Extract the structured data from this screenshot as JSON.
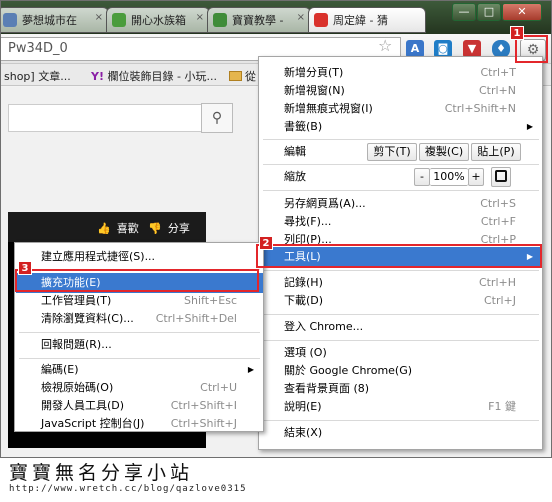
{
  "tabs": [
    {
      "label": "夢想城市在",
      "close": "×",
      "icon_color": "#5a7fb4"
    },
    {
      "label": "開心水族箱",
      "close": "×",
      "icon_color": "#4a9c3c"
    },
    {
      "label": "寶寶教學 -",
      "close": "×",
      "icon_color": "#3f8c38"
    },
    {
      "label": "周定緯 - 猜",
      "close": "×",
      "icon_color": "#d9322c"
    }
  ],
  "window_controls": {
    "minimize": "—",
    "maximize": "□",
    "close": "✕"
  },
  "address": {
    "text": "Pw34D_0"
  },
  "toolbar_icons": [
    "star-icon",
    "translate-icon",
    "camera-icon",
    "thumb-down-icon",
    "shield-icon",
    "wrench-icon"
  ],
  "bookmarks": [
    {
      "label": "shop] 文章..."
    },
    {
      "label": "欄位裝飾目錄 - 小玩..."
    },
    {
      "label": "從"
    }
  ],
  "page_content": {
    "like_label": "喜歡",
    "share_label": "分享"
  },
  "menu": {
    "items": [
      {
        "label": "新增分頁(T)",
        "shortcut": "Ctrl+T"
      },
      {
        "label": "新增視窗(N)",
        "shortcut": "Ctrl+N"
      },
      {
        "label": "新增無痕式視窗(I)",
        "shortcut": "Ctrl+Shift+N"
      },
      {
        "label": "書籤(B)",
        "shortcut": ""
      },
      {
        "label": "編輯",
        "shortcut": ""
      },
      {
        "label": "縮放",
        "shortcut": ""
      },
      {
        "label": "另存網頁爲(A)...",
        "shortcut": "Ctrl+S"
      },
      {
        "label": "尋找(F)...",
        "shortcut": "Ctrl+F"
      },
      {
        "label": "列印(P)...",
        "shortcut": "Ctrl+P"
      },
      {
        "label": "工具(L)",
        "shortcut": ""
      },
      {
        "label": "記錄(H)",
        "shortcut": "Ctrl+H"
      },
      {
        "label": "下載(D)",
        "shortcut": "Ctrl+J"
      },
      {
        "label": "登入 Chrome...",
        "shortcut": ""
      },
      {
        "label": "選項 (O)",
        "shortcut": ""
      },
      {
        "label": "關於 Google Chrome(G)",
        "shortcut": ""
      },
      {
        "label": "查看背景頁面 (8)",
        "shortcut": ""
      },
      {
        "label": "說明(E)",
        "shortcut": "F1 鍵"
      },
      {
        "label": "結束(X)",
        "shortcut": ""
      }
    ],
    "edit_buttons": {
      "cut": "剪下(T)",
      "copy": "複製(C)",
      "paste": "貼上(P)"
    },
    "zoom": {
      "minus": "-",
      "value": "100%",
      "plus": "+"
    }
  },
  "submenu": {
    "items": [
      {
        "label": "建立應用程式捷徑(S)...",
        "shortcut": ""
      },
      {
        "label": "擴充功能(E)",
        "shortcut": ""
      },
      {
        "label": "工作管理員(T)",
        "shortcut": "Shift+Esc"
      },
      {
        "label": "清除瀏覽資料(C)...",
        "shortcut": "Ctrl+Shift+Del"
      },
      {
        "label": "回報問題(R)...",
        "shortcut": ""
      },
      {
        "label": "編碼(E)",
        "shortcut": ""
      },
      {
        "label": "檢視原始碼(O)",
        "shortcut": "Ctrl+U"
      },
      {
        "label": "開發人員工具(D)",
        "shortcut": "Ctrl+Shift+I"
      },
      {
        "label": "JavaScript 控制台(J)",
        "shortcut": "Ctrl+Shift+J"
      }
    ]
  },
  "step_badges": [
    "1",
    "2",
    "3"
  ],
  "footer": {
    "title": "寶寶無名分享小站",
    "url": "http://www.wretch.cc/blog/qazlove0315"
  },
  "colors": {
    "highlight": "#3a79cf",
    "annotation_red": "#e3262b"
  }
}
